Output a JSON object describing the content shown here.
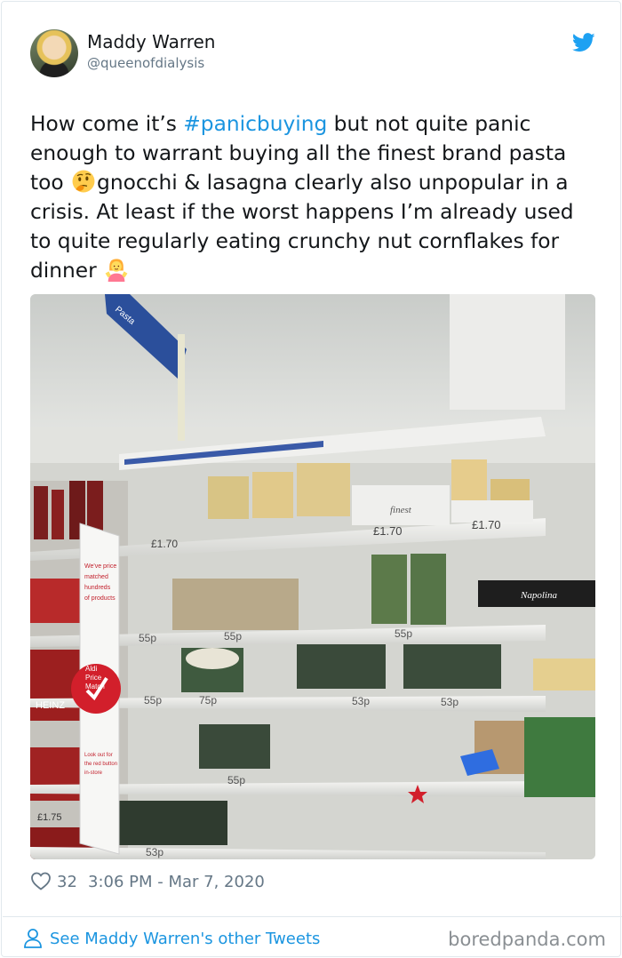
{
  "author": {
    "name": "Maddy Warren",
    "handle": "@queenofdialysis"
  },
  "tweet": {
    "text_part1": "How come it’s ",
    "hashtag": "#panicbuying",
    "text_part2": " but not quite panic enough to warrant buying all the finest brand pasta too ",
    "text_part3": "gnocchi & lasagna clearly also unpopular in a crisis. At least if the worst happens I’m already used to quite regularly eating crunchy nut cornflakes for dinner ",
    "emoji_1": "thinking-face-emoji",
    "emoji_2": "woman-shrugging-emoji"
  },
  "photo": {
    "description_icon": "supermarket-shelf-photo",
    "aisle_sign": "Pasta",
    "price_match_sign": {
      "top": "We've price matched hundreds of products",
      "badge": "Aldi Price Match",
      "bottom": "Look out for the red button in-store"
    },
    "finest_label": "finest",
    "prices": {
      "p170": "£1.70",
      "p55": "55p",
      "p75": "75p",
      "p53": "53p",
      "p175": "£1.75",
      "heinz": "HEINZ",
      "napolina": "Napolina"
    }
  },
  "stats": {
    "likes": "32",
    "timestamp": "3:06 PM - Mar 7, 2020"
  },
  "more": {
    "label": "See Maddy Warren's other Tweets"
  },
  "watermark": "boredpanda.com",
  "colors": {
    "link": "#1b95e0",
    "text": "#14171a",
    "muted": "#657786",
    "border": "#e1e8ed"
  }
}
